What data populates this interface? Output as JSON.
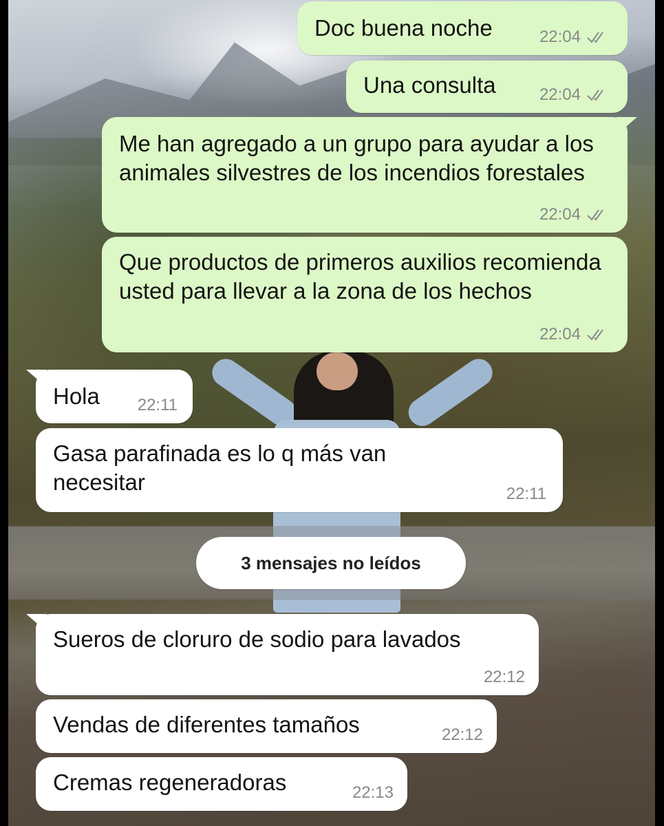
{
  "messages": [
    {
      "dir": "out",
      "text": "Doc buena noche",
      "time": "22:04",
      "status": "read"
    },
    {
      "dir": "out",
      "text": "Una consulta",
      "time": "22:04",
      "status": "read"
    },
    {
      "dir": "out",
      "text": "Me han agregado a un grupo para ayudar a los animales silvestres de los incendios forestales",
      "time": "22:04",
      "status": "read"
    },
    {
      "dir": "out",
      "text": "Que productos de primeros auxilios recomienda usted para llevar a la zona de los hechos",
      "time": "22:04",
      "status": "read"
    },
    {
      "dir": "in",
      "text": "Hola",
      "time": "22:11"
    },
    {
      "dir": "in",
      "text": "Gasa parafinada es lo q más van necesitar",
      "time": "22:11"
    },
    {
      "dir": "in",
      "text": "Sueros de cloruro de sodio para lavados",
      "time": "22:12"
    },
    {
      "dir": "in",
      "text": "Vendas de diferentes tamaños",
      "time": "22:12"
    },
    {
      "dir": "in",
      "text": "Cremas regeneradoras",
      "time": "22:13"
    }
  ],
  "unread_divider": "3 mensajes no leídos",
  "colors": {
    "outgoing": "#dcf8c6",
    "incoming": "#ffffff",
    "meta": "#888888"
  },
  "icons": {
    "read_receipt": "double-check-icon"
  }
}
